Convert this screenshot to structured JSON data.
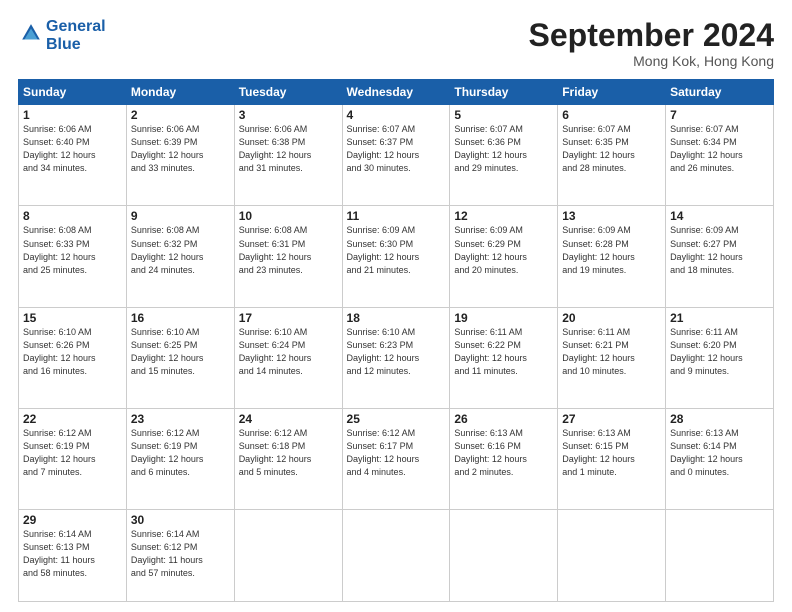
{
  "header": {
    "logo_line1": "General",
    "logo_line2": "Blue",
    "month": "September 2024",
    "location": "Mong Kok, Hong Kong"
  },
  "days_of_week": [
    "Sunday",
    "Monday",
    "Tuesday",
    "Wednesday",
    "Thursday",
    "Friday",
    "Saturday"
  ],
  "weeks": [
    [
      {
        "num": "1",
        "rise": "6:06 AM",
        "set": "6:40 PM",
        "daylight": "12 hours and 34 minutes."
      },
      {
        "num": "2",
        "rise": "6:06 AM",
        "set": "6:39 PM",
        "daylight": "12 hours and 33 minutes."
      },
      {
        "num": "3",
        "rise": "6:06 AM",
        "set": "6:38 PM",
        "daylight": "12 hours and 31 minutes."
      },
      {
        "num": "4",
        "rise": "6:07 AM",
        "set": "6:37 PM",
        "daylight": "12 hours and 30 minutes."
      },
      {
        "num": "5",
        "rise": "6:07 AM",
        "set": "6:36 PM",
        "daylight": "12 hours and 29 minutes."
      },
      {
        "num": "6",
        "rise": "6:07 AM",
        "set": "6:35 PM",
        "daylight": "12 hours and 28 minutes."
      },
      {
        "num": "7",
        "rise": "6:07 AM",
        "set": "6:34 PM",
        "daylight": "12 hours and 26 minutes."
      }
    ],
    [
      {
        "num": "8",
        "rise": "6:08 AM",
        "set": "6:33 PM",
        "daylight": "12 hours and 25 minutes."
      },
      {
        "num": "9",
        "rise": "6:08 AM",
        "set": "6:32 PM",
        "daylight": "12 hours and 24 minutes."
      },
      {
        "num": "10",
        "rise": "6:08 AM",
        "set": "6:31 PM",
        "daylight": "12 hours and 23 minutes."
      },
      {
        "num": "11",
        "rise": "6:09 AM",
        "set": "6:30 PM",
        "daylight": "12 hours and 21 minutes."
      },
      {
        "num": "12",
        "rise": "6:09 AM",
        "set": "6:29 PM",
        "daylight": "12 hours and 20 minutes."
      },
      {
        "num": "13",
        "rise": "6:09 AM",
        "set": "6:28 PM",
        "daylight": "12 hours and 19 minutes."
      },
      {
        "num": "14",
        "rise": "6:09 AM",
        "set": "6:27 PM",
        "daylight": "12 hours and 18 minutes."
      }
    ],
    [
      {
        "num": "15",
        "rise": "6:10 AM",
        "set": "6:26 PM",
        "daylight": "12 hours and 16 minutes."
      },
      {
        "num": "16",
        "rise": "6:10 AM",
        "set": "6:25 PM",
        "daylight": "12 hours and 15 minutes."
      },
      {
        "num": "17",
        "rise": "6:10 AM",
        "set": "6:24 PM",
        "daylight": "12 hours and 14 minutes."
      },
      {
        "num": "18",
        "rise": "6:10 AM",
        "set": "6:23 PM",
        "daylight": "12 hours and 12 minutes."
      },
      {
        "num": "19",
        "rise": "6:11 AM",
        "set": "6:22 PM",
        "daylight": "12 hours and 11 minutes."
      },
      {
        "num": "20",
        "rise": "6:11 AM",
        "set": "6:21 PM",
        "daylight": "12 hours and 10 minutes."
      },
      {
        "num": "21",
        "rise": "6:11 AM",
        "set": "6:20 PM",
        "daylight": "12 hours and 9 minutes."
      }
    ],
    [
      {
        "num": "22",
        "rise": "6:12 AM",
        "set": "6:19 PM",
        "daylight": "12 hours and 7 minutes."
      },
      {
        "num": "23",
        "rise": "6:12 AM",
        "set": "6:19 PM",
        "daylight": "12 hours and 6 minutes."
      },
      {
        "num": "24",
        "rise": "6:12 AM",
        "set": "6:18 PM",
        "daylight": "12 hours and 5 minutes."
      },
      {
        "num": "25",
        "rise": "6:12 AM",
        "set": "6:17 PM",
        "daylight": "12 hours and 4 minutes."
      },
      {
        "num": "26",
        "rise": "6:13 AM",
        "set": "6:16 PM",
        "daylight": "12 hours and 2 minutes."
      },
      {
        "num": "27",
        "rise": "6:13 AM",
        "set": "6:15 PM",
        "daylight": "12 hours and 1 minute."
      },
      {
        "num": "28",
        "rise": "6:13 AM",
        "set": "6:14 PM",
        "daylight": "12 hours and 0 minutes."
      }
    ],
    [
      {
        "num": "29",
        "rise": "6:14 AM",
        "set": "6:13 PM",
        "daylight": "11 hours and 58 minutes."
      },
      {
        "num": "30",
        "rise": "6:14 AM",
        "set": "6:12 PM",
        "daylight": "11 hours and 57 minutes."
      },
      null,
      null,
      null,
      null,
      null
    ]
  ]
}
